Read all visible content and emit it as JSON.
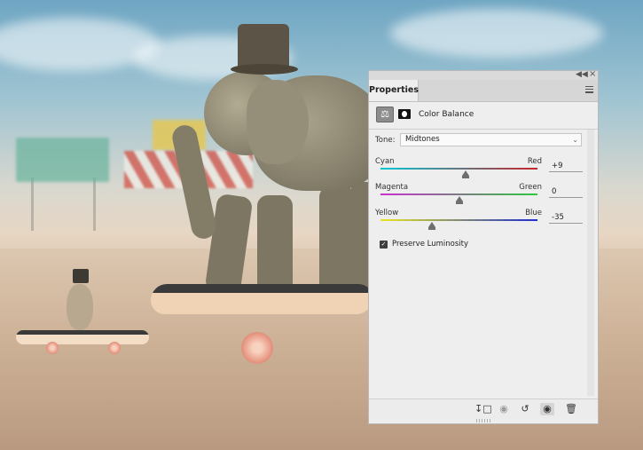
{
  "panel": {
    "tab_label": "Properties",
    "adjustment_title": "Color Balance",
    "tone": {
      "label": "Tone:",
      "value": "Midtones"
    },
    "sliders": [
      {
        "left": "Cyan",
        "right": "Red",
        "value": "+9",
        "level": 9,
        "range": [
          -100,
          100
        ],
        "colors": [
          "#00c8d6",
          "#c8242a"
        ]
      },
      {
        "left": "Magenta",
        "right": "Green",
        "value": "0",
        "level": 0,
        "range": [
          -100,
          100
        ],
        "colors": [
          "#cc2fd0",
          "#2cc83c"
        ]
      },
      {
        "left": "Yellow",
        "right": "Blue",
        "value": "-35",
        "level": -35,
        "range": [
          -100,
          100
        ],
        "colors": [
          "#e8e620",
          "#1c2fd0"
        ]
      }
    ],
    "preserve_luminosity": {
      "label": "Preserve Luminosity",
      "checked": true
    },
    "icons": {
      "adjustment": "color-balance-icon",
      "mask": "layer-mask-icon",
      "menu": "panel-menu-icon",
      "bottom": [
        "clip-to-layer-icon",
        "view-previous-icon",
        "reset-icon",
        "visibility-eye-icon",
        "delete-trash-icon"
      ]
    }
  }
}
